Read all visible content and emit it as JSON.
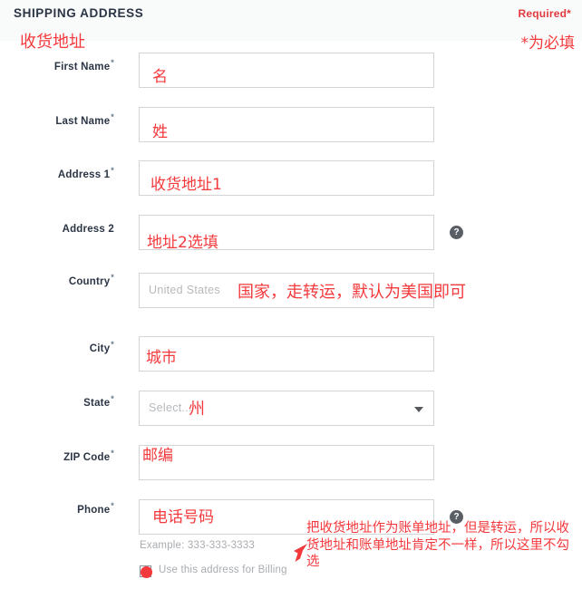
{
  "header": {
    "title": "SHIPPING ADDRESS",
    "required_label": "Required*",
    "annotation_title": "收货地址",
    "annotation_required": "*为必填"
  },
  "form": {
    "fields": [
      {
        "label": "First Name",
        "required": true,
        "placeholder": "",
        "value": "",
        "annotation": "名",
        "type": "text"
      },
      {
        "label": "Last Name",
        "required": true,
        "placeholder": "",
        "value": "",
        "annotation": "姓",
        "type": "text"
      },
      {
        "label": "Address 1",
        "required": true,
        "placeholder": "",
        "value": "",
        "annotation": "收货地址1",
        "type": "text"
      },
      {
        "label": "Address 2",
        "required": false,
        "placeholder": "",
        "value": "",
        "annotation": "地址2选填",
        "type": "text",
        "help_icon": "question-mark-icon"
      },
      {
        "label": "Country",
        "required": true,
        "placeholder": "United States",
        "value": "",
        "annotation": "国家，走转运，默认为美国即可",
        "type": "text"
      },
      {
        "label": "City",
        "required": true,
        "placeholder": "",
        "value": "",
        "annotation": "城市",
        "type": "text"
      },
      {
        "label": "State",
        "required": true,
        "placeholder": "Select...",
        "value": "",
        "annotation": "州",
        "type": "select"
      },
      {
        "label": "ZIP Code",
        "required": true,
        "placeholder": "",
        "value": "",
        "annotation": "邮编",
        "type": "text"
      },
      {
        "label": "Phone",
        "required": true,
        "placeholder": "",
        "value": "",
        "annotation": "电话号码",
        "type": "text",
        "help_icon": "question-mark-icon"
      }
    ],
    "phone_example": "Example: 333-333-3333",
    "billing_checkbox_label": "Use this address for Billing",
    "billing_checkbox_checked": false,
    "billing_annotation": "把收货地址作为账单地址，但是转运，所以收货地址和账单地址肯定不一样，所以这里不勾选"
  },
  "colors": {
    "annotation_red": "#f4393c",
    "required_red": "#e03a3e",
    "label_dark": "#2b3545",
    "border_gray": "#d2d4d6",
    "placeholder_gray": "#b6b9bc",
    "header_bg": "#f9fafa",
    "help_icon_bg": "#5a5f66"
  }
}
